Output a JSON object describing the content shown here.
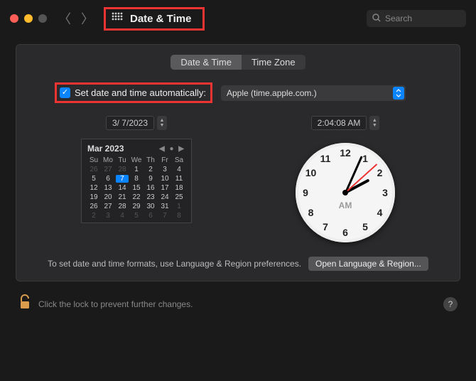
{
  "window": {
    "title": "Date & Time",
    "search_placeholder": "Search"
  },
  "tabs": {
    "date_time": "Date & Time",
    "time_zone": "Time Zone"
  },
  "auto": {
    "label": "Set date and time automatically:",
    "server": "Apple (time.apple.com.)"
  },
  "date_field": "3/  7/2023",
  "time_field": "2:04:08 AM",
  "calendar": {
    "title": "Mar 2023",
    "dow": [
      "Su",
      "Mo",
      "Tu",
      "We",
      "Th",
      "Fr",
      "Sa"
    ],
    "cells": [
      {
        "t": "26",
        "dim": true
      },
      {
        "t": "27",
        "dim": true
      },
      {
        "t": "28",
        "dim": true
      },
      {
        "t": "1"
      },
      {
        "t": "2"
      },
      {
        "t": "3"
      },
      {
        "t": "4"
      },
      {
        "t": "5"
      },
      {
        "t": "6"
      },
      {
        "t": "7",
        "sel": true
      },
      {
        "t": "8"
      },
      {
        "t": "9"
      },
      {
        "t": "10"
      },
      {
        "t": "11"
      },
      {
        "t": "12"
      },
      {
        "t": "13"
      },
      {
        "t": "14"
      },
      {
        "t": "15"
      },
      {
        "t": "16"
      },
      {
        "t": "17"
      },
      {
        "t": "18"
      },
      {
        "t": "19"
      },
      {
        "t": "20"
      },
      {
        "t": "21"
      },
      {
        "t": "22"
      },
      {
        "t": "23"
      },
      {
        "t": "24"
      },
      {
        "t": "25"
      },
      {
        "t": "26"
      },
      {
        "t": "27"
      },
      {
        "t": "28"
      },
      {
        "t": "29"
      },
      {
        "t": "30"
      },
      {
        "t": "31"
      },
      {
        "t": "1",
        "dim": true
      },
      {
        "t": "2",
        "dim": true
      },
      {
        "t": "3",
        "dim": true
      },
      {
        "t": "4",
        "dim": true
      },
      {
        "t": "5",
        "dim": true
      },
      {
        "t": "6",
        "dim": true
      },
      {
        "t": "7",
        "dim": true
      },
      {
        "t": "8",
        "dim": true
      }
    ]
  },
  "clock": {
    "ampm": "AM"
  },
  "hint": {
    "text": "To set date and time formats, use Language & Region preferences.",
    "button": "Open Language & Region..."
  },
  "footer": {
    "lock_text": "Click the lock to prevent further changes.",
    "help": "?"
  }
}
